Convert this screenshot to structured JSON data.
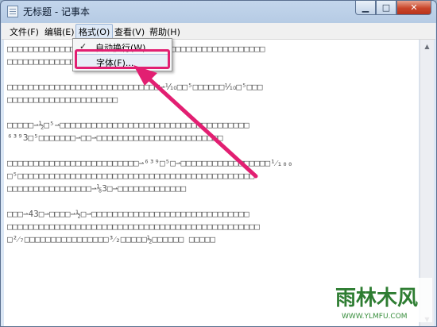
{
  "window": {
    "title": "无标题 - 记事本"
  },
  "menu": {
    "items": [
      "文件(F)",
      "编辑(E)",
      "格式(O)",
      "查看(V)",
      "帮助(H)"
    ],
    "active_index": 2
  },
  "format_menu": {
    "items": [
      {
        "label": "自动换行(W)",
        "checked": true
      },
      {
        "label": "字体(F)...",
        "checked": false
      }
    ],
    "highlighted_index": 1
  },
  "editor": {
    "lines": [
      "□□□□□□□□□□□□□□□□□□□□□□□□□□□□□□□□□□□□□□□□□□□□□□□□□",
      "□□□□□□□□□□□□□□□□□□□□□□□□□□□□",
      "",
      "□□□□□□□□□□□□□□□□□□□□□□□□□□□□□⇀⅒□□⁵□□□□□□⅒□⁵□□□",
      "□□□□□□□□□□□□□□□□□□□□□",
      "",
      "□□□□□⇀½□⁵⇀□□□□□□□□□□□□□□□□□□□□□□□□□□□□□□□□□□□□",
      "⁶³⁹3□⁵□□□□□□□⇀□□⇀□□□□□□□□□□□□□□□□□□□□□□□□",
      "",
      "□□□□□□□□□□□□□□□□□□□□□□□□□⇀⁶³⁹□⁵□⇀□□□□□□□□□□□□□□□□□¹⁄₁₀₀",
      "□⁵□□□□□□□□□□□□□□□□□□□□□□□□□□□□□□□□□□□□□□□□□□□□□",
      "□□□□□□□□□□□□□□□□⇀⅛3□⇀□□□□□□□□□□□□□",
      "",
      "□□□⇀43□⇀□□□□⇀½□⇀□□□□□□□□□□□□□□□□□□□□□□□□□□□□□□",
      "□□□□□□□□□□□□□□□□□□□□□□□□□□□□□□□□□□□□□□□□□□□□□□□□",
      "□²⁄₇□□□□□□□□□□□□□□□□³⁄₂□□□□□½□□□□□□ □□□□□"
    ]
  },
  "watermark": {
    "brand": "雨林木风",
    "url": "WWW.YLMFU.COM"
  },
  "colors": {
    "annotation": "#e21f72"
  }
}
